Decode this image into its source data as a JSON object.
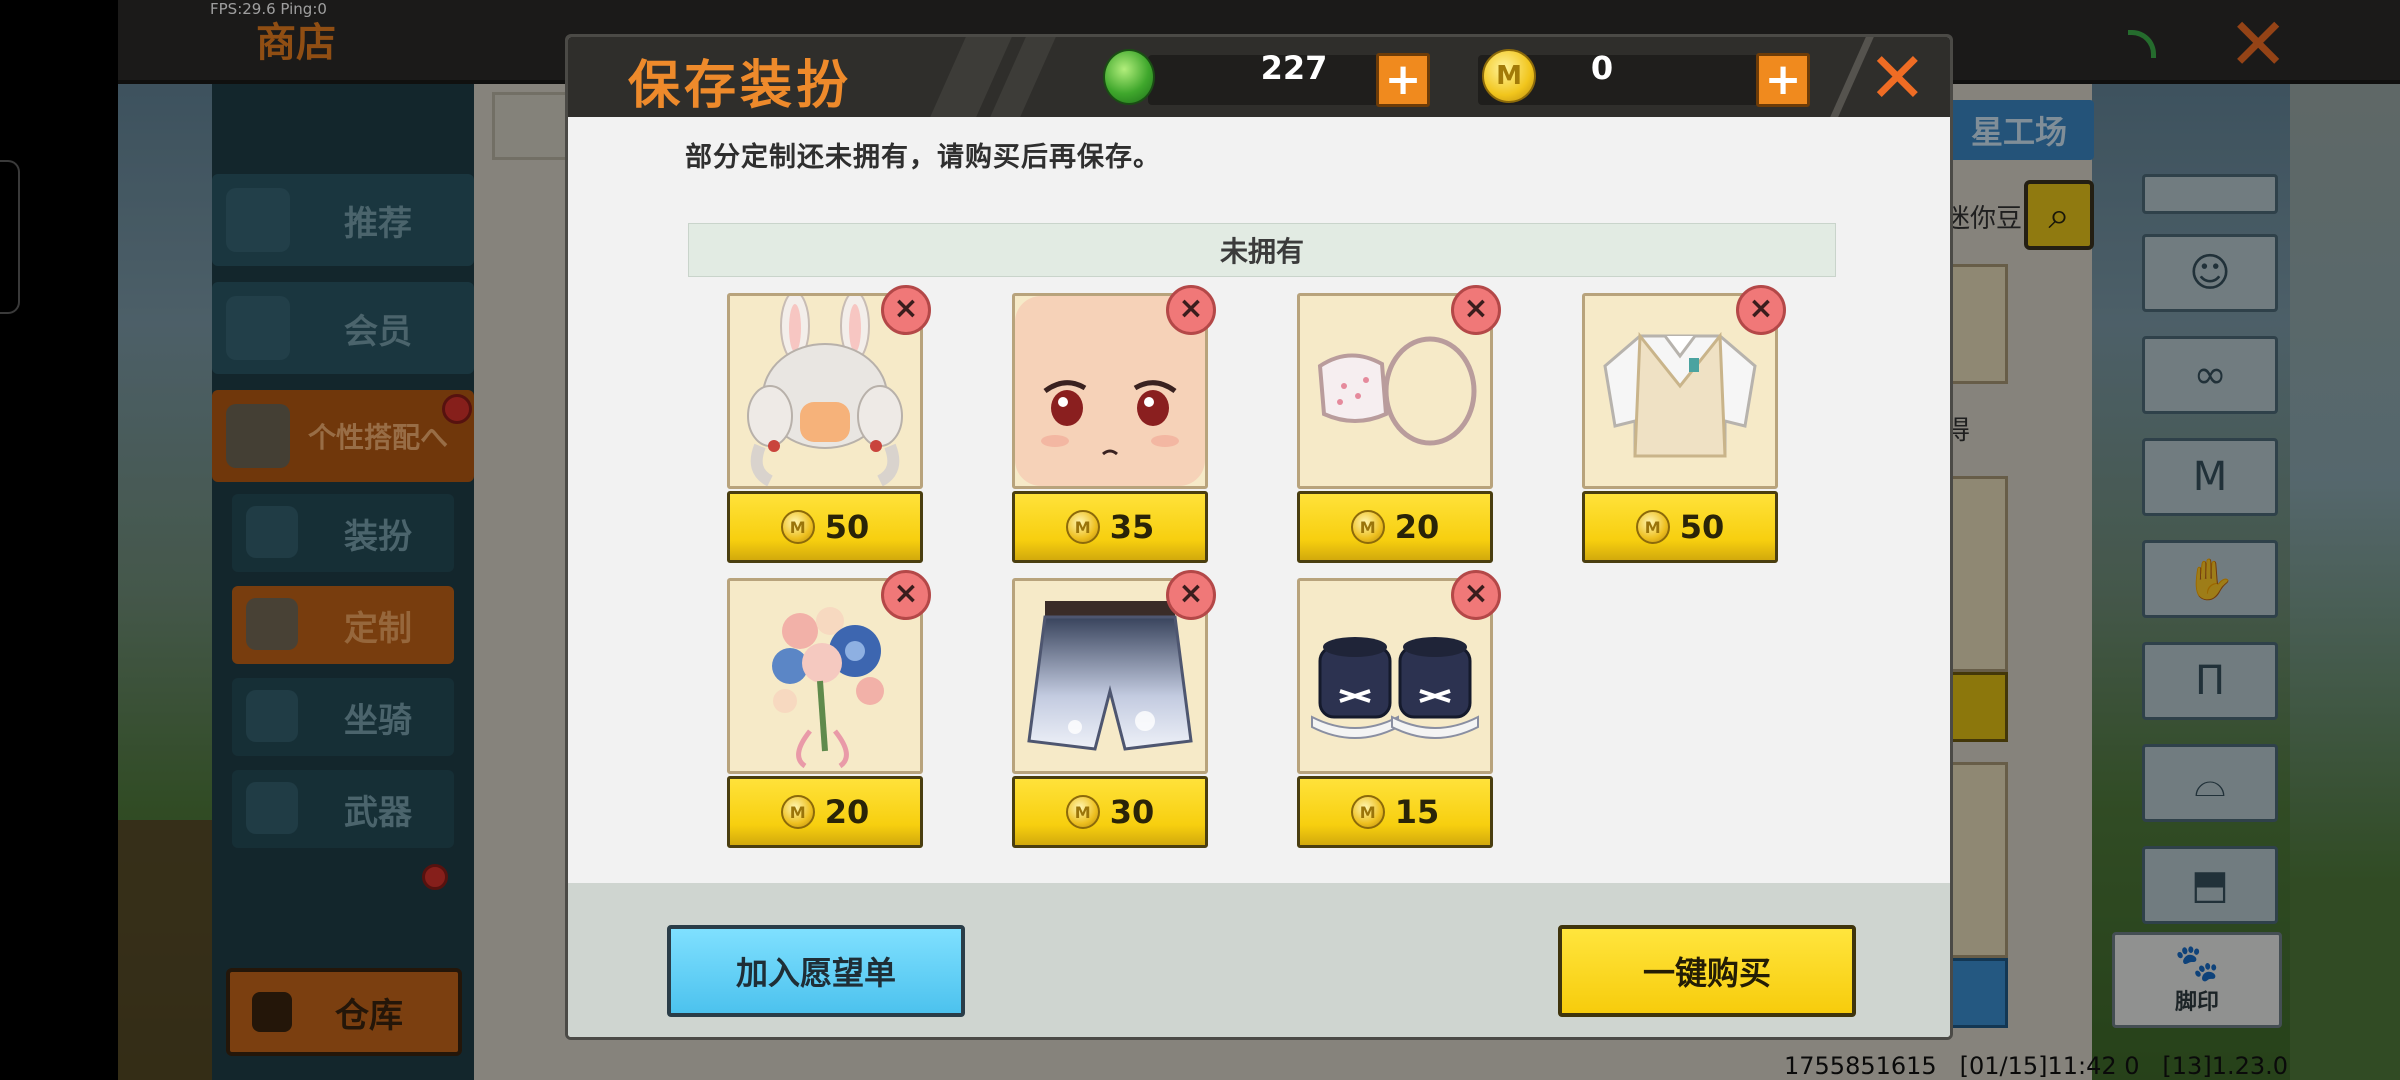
{
  "hud": {
    "fps": "FPS:29.6  Ping:0"
  },
  "shop": {
    "title": "商店",
    "star_tab": "星工场",
    "mini_text": "迷你豆",
    "side_text": "得",
    "footer_info": "1755851615   [01/15]11:42 0   [13]1.23.0",
    "paw_label": "脚印"
  },
  "sidebar": {
    "items": [
      {
        "label": "推荐"
      },
      {
        "label": "会员"
      },
      {
        "label": "个性搭配へ"
      },
      {
        "label": "装扮"
      },
      {
        "label": "定制"
      },
      {
        "label": "坐骑"
      },
      {
        "label": "武器"
      }
    ],
    "warehouse": "仓库"
  },
  "modal": {
    "title": "保存装扮",
    "gems": "227",
    "coins": "0",
    "coin_glyph": "M",
    "note": "部分定制还未拥有，请购买后再保存。",
    "section_header": "未拥有",
    "remove_glyph": "×",
    "close_glyph": "✕",
    "items": [
      {
        "name": "rabbit-ear-hair",
        "price": "50"
      },
      {
        "name": "face-eyes",
        "price": "35"
      },
      {
        "name": "face-mask",
        "price": "20"
      },
      {
        "name": "sweater-vest",
        "price": "50"
      },
      {
        "name": "flower-bouquet",
        "price": "20"
      },
      {
        "name": "gradient-shorts",
        "price": "30"
      },
      {
        "name": "sneakers",
        "price": "15"
      }
    ],
    "wishlist_button": "加入愿望单",
    "buy_all_button": "一键购买"
  },
  "colors": {
    "accent_orange": "#ee8a2b",
    "price_yellow": "#f7cf0f",
    "wish_blue": "#4cc2ee",
    "remove_red": "#f07878"
  }
}
